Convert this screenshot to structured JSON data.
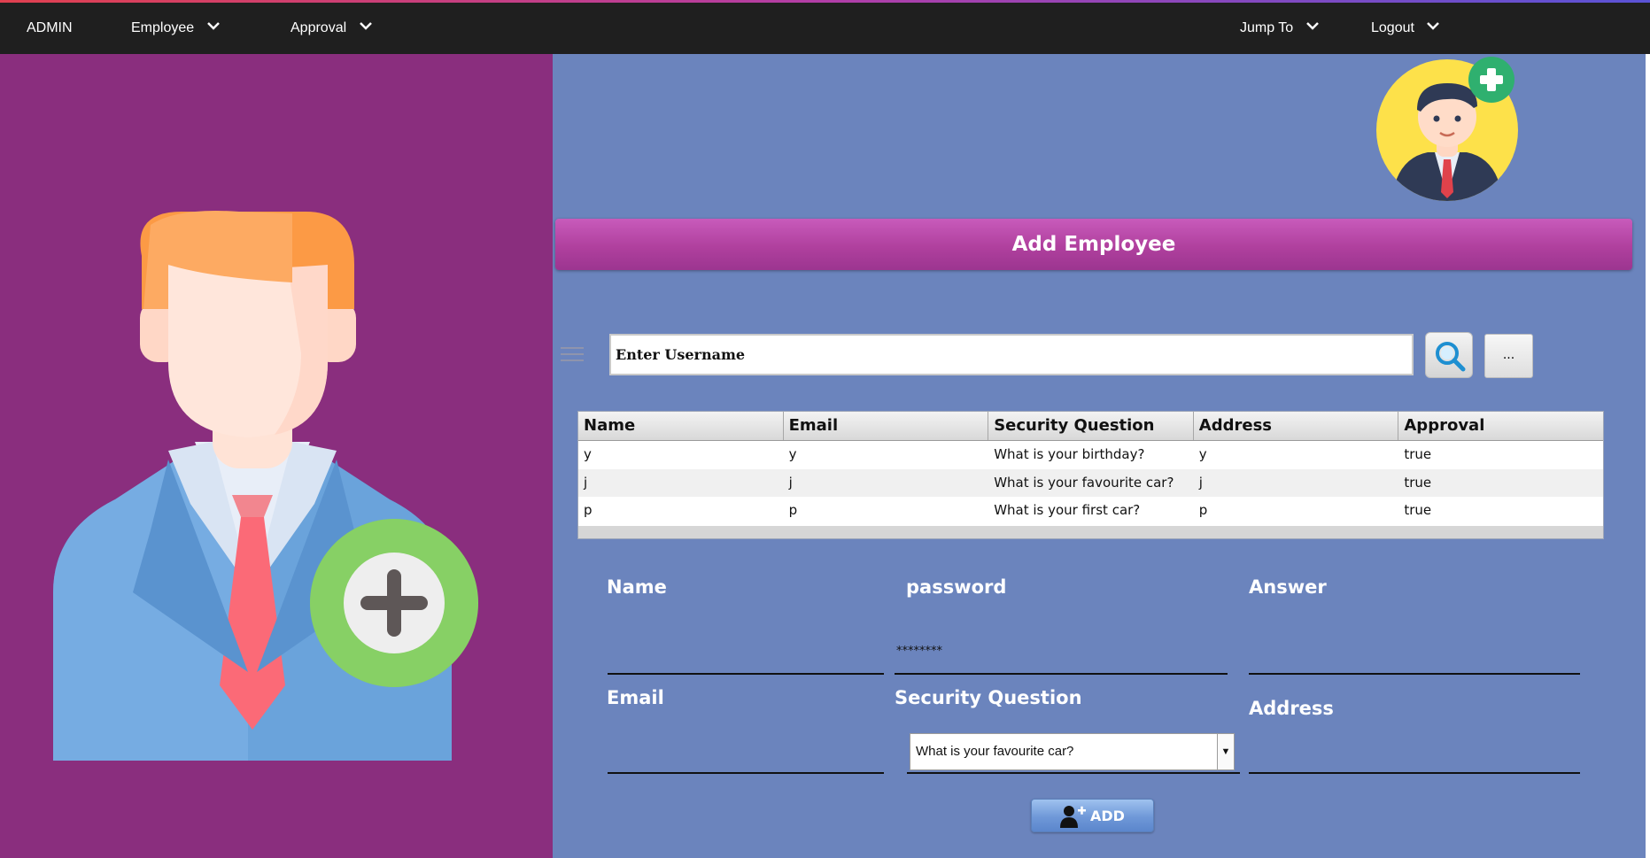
{
  "nav": {
    "admin": "ADMIN",
    "employee": "Employee",
    "approval": "Approval",
    "jump_to": "Jump To",
    "logout": "Logout"
  },
  "page": {
    "title": "Add Employee"
  },
  "search": {
    "placeholder": "Enter Username",
    "more_label": "..."
  },
  "table": {
    "headers": [
      "Name",
      "Email",
      "Security Question",
      "Address",
      "Approval"
    ],
    "rows": [
      [
        "y",
        "y",
        "What is your birthday?",
        "y",
        "true"
      ],
      [
        "j",
        "j",
        "What is your favourite car?",
        "j",
        "true"
      ],
      [
        "p",
        "p",
        "What is your first car?",
        "p",
        "true"
      ]
    ]
  },
  "form": {
    "name_label": "Name",
    "password_label": "password",
    "answer_label": "Answer",
    "email_label": "Email",
    "security_question_label": "Security Question",
    "address_label": "Address",
    "password_value": "********",
    "security_question_value": "What is your favourite car?",
    "add_label": "ADD"
  },
  "colors": {
    "navbar": "#1f1f1f",
    "left_panel": "#8a2e7e",
    "right_panel": "#6b84bd",
    "title_bar": "#b0409e",
    "add_button": "#6f98d8",
    "plus_badge": "#7ccb5a"
  },
  "icons": {
    "nav_chevron": "chevron-down-icon",
    "search": "magnifier-icon",
    "add_user": "add-user-icon",
    "menu": "hamburger-icon"
  }
}
